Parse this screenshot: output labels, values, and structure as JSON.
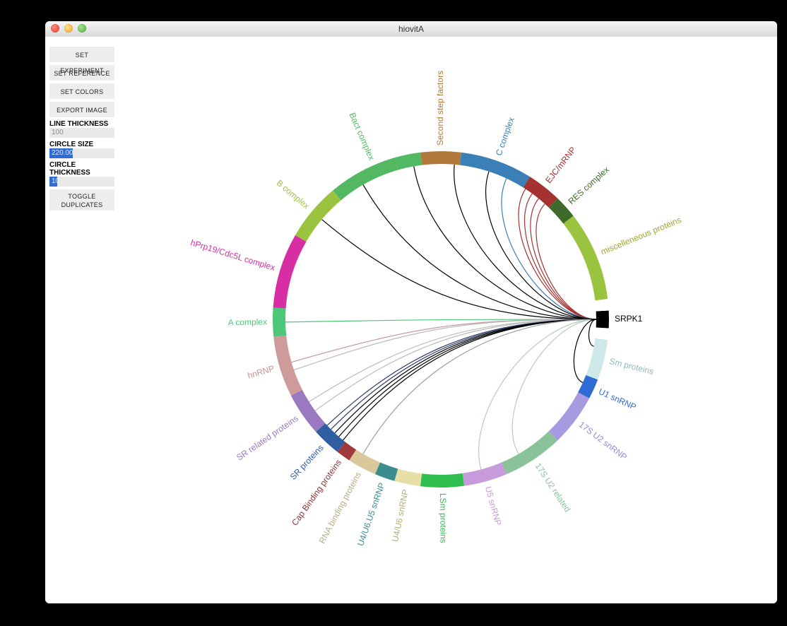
{
  "window": {
    "title": "hiovitA"
  },
  "sidebar": {
    "buttons": {
      "set_experiment": "SET EXPERIMENT",
      "set_reference": "SET REFERENCE",
      "set_colors": "SET COLORS",
      "export_image": "EXPORT IMAGE",
      "toggle_duplicates_l1": "TOGGLE",
      "toggle_duplicates_l2": "DUPLICATES"
    },
    "params": {
      "line_thickness": {
        "label": "LINE THICKNESS",
        "value": "100",
        "fill_pct": 0
      },
      "circle_size": {
        "label": "CIRCLE SIZE",
        "value": "220.00",
        "fill_pct": 36
      },
      "circle_thick": {
        "label": "CIRCLE THICKNESS",
        "value": "10",
        "fill_pct": 12
      }
    }
  },
  "chart_data": {
    "type": "chord",
    "title": "",
    "focus_node": "SRPK1",
    "ring_inner_radius": 220,
    "ring_thickness": 18,
    "label_offset": 8,
    "center": [
      560,
      400
    ],
    "segments": [
      {
        "id": "secondstep",
        "label": "Second step factors",
        "start_deg": -97,
        "end_deg": -83,
        "color": "#b07a3a",
        "label_color": "#b07a3a"
      },
      {
        "id": "bact",
        "label": "Bact complex",
        "start_deg": -130,
        "end_deg": -97,
        "color": "#53b862",
        "label_color": "#53b862"
      },
      {
        "id": "bcomplex",
        "label": "B complex",
        "start_deg": -150,
        "end_deg": -130,
        "color": "#9ac43f",
        "label_color": "#9ac43f"
      },
      {
        "id": "hprp19",
        "label": "hPrp19/Cdc5L complex",
        "start_deg": -176,
        "end_deg": -150,
        "color": "#d72ea3",
        "label_color": "#d72ea3"
      },
      {
        "id": "acomplex",
        "label": "A complex",
        "start_deg": -186,
        "end_deg": -176,
        "color": "#4cc777",
        "label_color": "#4cc777"
      },
      {
        "id": "hnrnp",
        "label": "hnRNP",
        "start_deg": -207,
        "end_deg": -186,
        "color": "#cf9a9a",
        "label_color": "#c49393"
      },
      {
        "id": "srrel",
        "label": "SR related proteins",
        "start_deg": -222,
        "end_deg": -207,
        "color": "#9a79c1",
        "label_color": "#9a79c1"
      },
      {
        "id": "srprot",
        "label": "SR proteins",
        "start_deg": -232,
        "end_deg": -222,
        "color": "#2f5ea3",
        "label_color": "#2f5ea3"
      },
      {
        "id": "capbind",
        "label": "Cap Binding proteins",
        "start_deg": -237,
        "end_deg": -232,
        "color": "#a03a3a",
        "label_color": "#8a3636"
      },
      {
        "id": "rnabind",
        "label": "RNA binding proteins",
        "start_deg": -247,
        "end_deg": -237,
        "color": "#d9c89a",
        "label_color": "#b8ab84"
      },
      {
        "id": "u4u6u5",
        "label": "U4/U6.U5 snRNP",
        "start_deg": -254,
        "end_deg": -247,
        "color": "#3b8d8e",
        "label_color": "#3b8d8e"
      },
      {
        "id": "u4u6",
        "label": "U4/U6 snRNP",
        "start_deg": -263,
        "end_deg": -254,
        "color": "#e7dfa5",
        "label_color": "#b5ad77"
      },
      {
        "id": "lsm",
        "label": "LSm proteins",
        "start_deg": -278,
        "end_deg": -263,
        "color": "#2fbf4e",
        "label_color": "#2fbf4e"
      },
      {
        "id": "u5",
        "label": "U5 snRNP",
        "start_deg": -293,
        "end_deg": -278,
        "color": "#c69adb",
        "label_color": "#c69adb"
      },
      {
        "id": "u2rel",
        "label": "17S U2 related",
        "start_deg": -314,
        "end_deg": -293,
        "color": "#8ac39a",
        "label_color": "#8ac39a"
      },
      {
        "id": "u2snrnp",
        "label": "17S U2 snRNP",
        "start_deg": -332,
        "end_deg": -314,
        "color": "#a79ae0",
        "label_color": "#9688d6"
      },
      {
        "id": "u1",
        "label": "U1 snRNP",
        "start_deg": -339,
        "end_deg": -332,
        "color": "#2f6bd4",
        "label_color": "#2f6bd4"
      },
      {
        "id": "sm",
        "label": "Sm proteins",
        "start_deg": -353,
        "end_deg": -339,
        "color": "#cfe8e8",
        "label_color": "#8fb9bb"
      },
      {
        "id": "gap1",
        "label": "",
        "start_deg": -357,
        "end_deg": -353,
        "color": "#ffffff",
        "label_color": "#000"
      },
      {
        "id": "srpk1",
        "label": "SRPK1",
        "start_deg": -363,
        "end_deg": -357,
        "color": "#000000",
        "label_color": "#000000"
      },
      {
        "id": "gap2",
        "label": "",
        "start_deg": -367,
        "end_deg": -363,
        "color": "#ffffff",
        "label_color": "#000"
      },
      {
        "id": "misc",
        "label": "miscelleneous proteins",
        "start_deg": -398,
        "end_deg": -367,
        "color": "#9ac43f",
        "label_color": "#9ea531"
      },
      {
        "id": "res",
        "label": "RES complex",
        "start_deg": -406,
        "end_deg": -398,
        "color": "#3e6a2a",
        "label_color": "#3e6a2a"
      },
      {
        "id": "ejc",
        "label": "EJC/mRNP",
        "start_deg": -418,
        "end_deg": -406,
        "color": "#a53131",
        "label_color": "#a53131"
      },
      {
        "id": "ccomplex",
        "label": "C complex",
        "start_deg": -443,
        "end_deg": -418,
        "color": "#3a7fb5",
        "label_color": "#3a7fb5"
      }
    ],
    "chords_hub_deg": -360,
    "chords": [
      {
        "to_deg": -85,
        "color": "#000000"
      },
      {
        "to_deg": -100,
        "color": "#000000"
      },
      {
        "to_deg": -120,
        "color": "#000000"
      },
      {
        "to_deg": -140,
        "color": "#000000"
      },
      {
        "to_deg": -181,
        "color": "#4cc777"
      },
      {
        "to_deg": -196,
        "color": "#c49aa0"
      },
      {
        "to_deg": -199,
        "color": "#bbbbbb"
      },
      {
        "to_deg": -212,
        "color": "#bbbbbb"
      },
      {
        "to_deg": -216,
        "color": "#bbbbbb"
      },
      {
        "to_deg": -223,
        "color": "#2a3c66"
      },
      {
        "to_deg": -225,
        "color": "#2a3c66"
      },
      {
        "to_deg": -227,
        "color": "#000000"
      },
      {
        "to_deg": -229,
        "color": "#000000"
      },
      {
        "to_deg": -231,
        "color": "#000000"
      },
      {
        "to_deg": -240,
        "color": "#9aa0a6"
      },
      {
        "to_deg": -285,
        "color": "#b7cdb7"
      },
      {
        "to_deg": -300,
        "color": "#b7cdb7"
      },
      {
        "to_deg": -336,
        "color": "#000000"
      },
      {
        "to_deg": -350,
        "color": "#000000"
      },
      {
        "to_deg": -408,
        "color": "#a53131"
      },
      {
        "to_deg": -411,
        "color": "#a53131"
      },
      {
        "to_deg": -414,
        "color": "#a53131"
      },
      {
        "to_deg": -417,
        "color": "#a53131"
      },
      {
        "to_deg": -425,
        "color": "#3a7fb5"
      },
      {
        "to_deg": -432,
        "color": "#000000"
      }
    ]
  }
}
